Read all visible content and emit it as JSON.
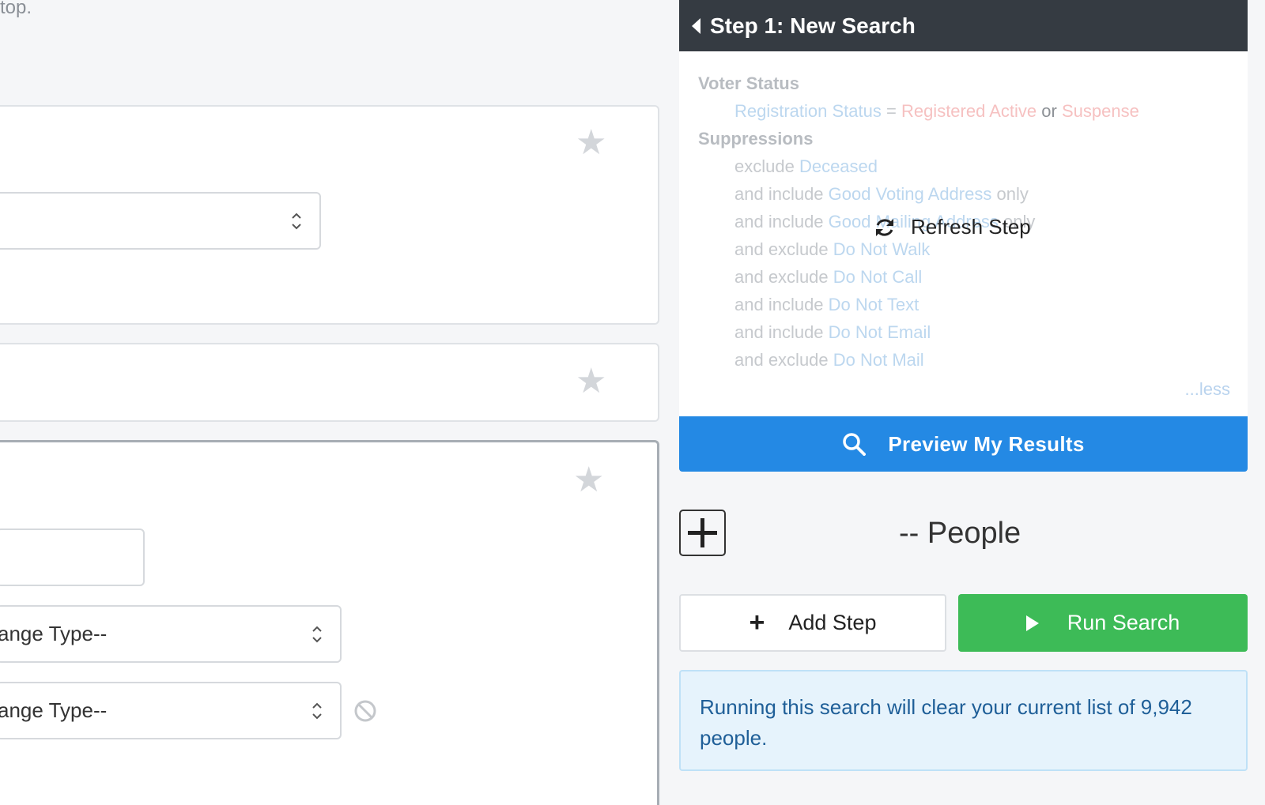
{
  "left": {
    "top_text": "top.",
    "field_range_type_1": "ange Type--",
    "field_range_type_2": "ange Type--"
  },
  "step": {
    "title": "Step 1: New Search",
    "sections": {
      "voter_status": "Voter Status",
      "suppressions": "Suppressions"
    },
    "criteria": {
      "registration_field": "Registration Status",
      "equals": " = ",
      "value_active": "Registered Active",
      "or": " or ",
      "value_suspense": "Suspense",
      "lines": [
        {
          "prefix": "exclude ",
          "item": "Deceased",
          "suffix": ""
        },
        {
          "prefix": "and include ",
          "item": "Good Voting Address",
          "suffix": " only"
        },
        {
          "prefix": "and include ",
          "item": "Good Mailing Address",
          "suffix": " only"
        },
        {
          "prefix": "and exclude ",
          "item": "Do Not Walk",
          "suffix": ""
        },
        {
          "prefix": "and exclude ",
          "item": "Do Not Call",
          "suffix": ""
        },
        {
          "prefix": "and include ",
          "item": "Do Not Text",
          "suffix": ""
        },
        {
          "prefix": "and include ",
          "item": "Do Not Email",
          "suffix": ""
        },
        {
          "prefix": "and exclude ",
          "item": "Do Not Mail",
          "suffix": ""
        }
      ]
    },
    "less_link": "...less",
    "refresh_label": "Refresh Step"
  },
  "actions": {
    "preview_label": "Preview My Results",
    "people_count_label": "-- People",
    "add_step_label": "Add Step",
    "run_search_label": "Run Search"
  },
  "notice": {
    "message": "Running this search will clear your current list of 9,942 people."
  },
  "colors": {
    "header_bg": "#353b42",
    "preview_blue": "#2489e4",
    "run_green": "#3dbb57",
    "notice_bg": "#e6f3fc",
    "notice_text": "#1f5f98"
  }
}
